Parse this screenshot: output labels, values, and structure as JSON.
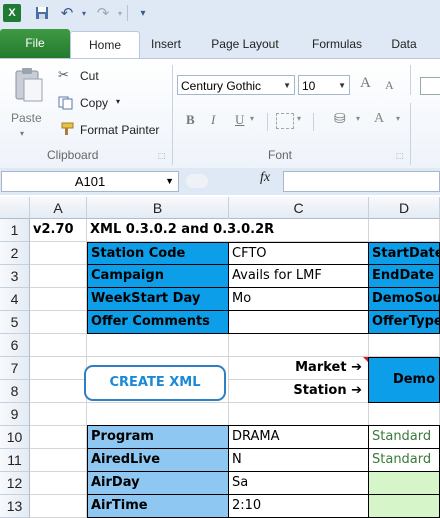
{
  "qat": {
    "app_icon": "X",
    "undo": "↶",
    "redo": "↷"
  },
  "tabs": [
    {
      "label": "File"
    },
    {
      "label": "Home"
    },
    {
      "label": "Insert"
    },
    {
      "label": "Page Layout"
    },
    {
      "label": "Formulas"
    },
    {
      "label": "Data"
    }
  ],
  "ribbon": {
    "paste": "Paste",
    "cut": "Cut",
    "copy": "Copy",
    "format_painter": "Format Painter",
    "clipboard_group": "Clipboard",
    "font_name": "Century Gothic",
    "font_size": "10",
    "font_group": "Font",
    "bold": "B",
    "italic": "I",
    "underline": "U",
    "grow": "A",
    "shrink": "A"
  },
  "formula_bar": {
    "name_box": "A101",
    "fx": "fx",
    "formula": ""
  },
  "columns": [
    "A",
    "B",
    "C",
    "D"
  ],
  "rows": [
    "1",
    "2",
    "3",
    "4",
    "5",
    "6",
    "7",
    "8",
    "9",
    "10",
    "11",
    "12",
    "13"
  ],
  "cells": {
    "a1": "v2.70",
    "b1": "XML 0.3.0.2 and 0.3.0.2R",
    "b2": "Station Code",
    "c2": "CFTO",
    "d2": "StartDate",
    "b3": "Campaign",
    "c3": "Avails for LMF",
    "d3": "EndDate",
    "b4": "WeekStart Day",
    "c4": "Mo",
    "d4": "DemoSou",
    "b5": "Offer Comments",
    "c5": "",
    "d5": "OfferType",
    "create_xml": "CREATE XML",
    "market": "Market ➔",
    "station": "Station ➔",
    "d78": "Demo",
    "b10": "Program",
    "c10": "DRAMA",
    "d10": "Standard",
    "b11": "AiredLive",
    "c11": "N",
    "d11": "Standard",
    "b12": "AirDay",
    "c12": "Sa",
    "d12": "",
    "b13": "AirTime",
    "c13": "2:10"
  },
  "colors": {
    "accent_blue": "#0c9ee8",
    "light_blue": "#8ec8f2",
    "green_fill": "#d6f5c8",
    "file_tab": "#2a7f31"
  }
}
